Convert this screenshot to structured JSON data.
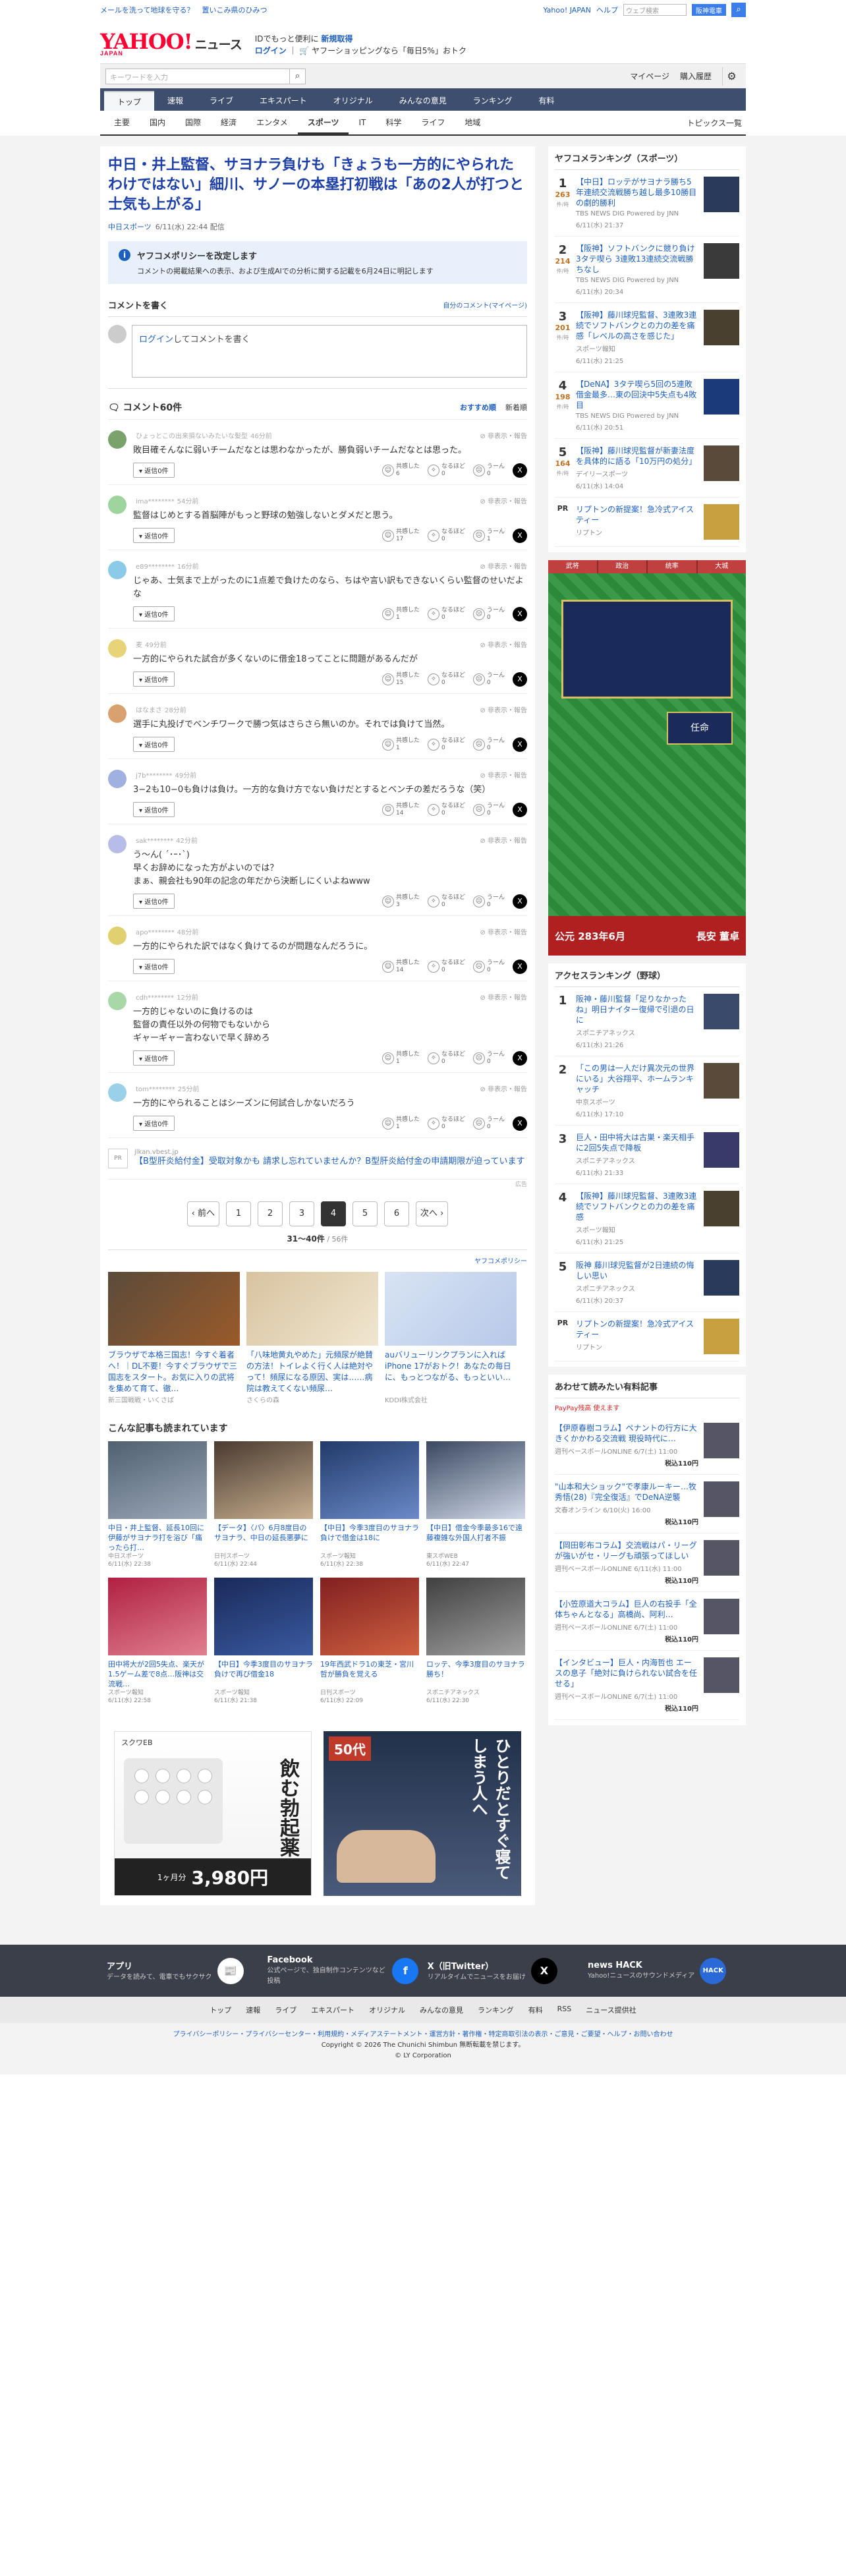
{
  "topbar": {
    "left1": "メールを洗って地球を守る？",
    "left2": "置いこみ県のひみつ",
    "yj": "Yahoo! JAPAN",
    "help": "ヘルプ",
    "search_ph": "ウェブ検索",
    "search_btn": "阪神電車"
  },
  "logo": {
    "main": "YAHOO!",
    "sub": "JAPAN",
    "news": "ニュース"
  },
  "promo": {
    "l1a": "IDでもっと便利に",
    "l1b": "新規取得",
    "l2a": "ログイン",
    "l2b": "ヤフーショッピングなら「毎日5%」おトク"
  },
  "tool": {
    "search_ph": "キーワードを入力",
    "mypage": "マイページ",
    "history": "購入履歴"
  },
  "gnav": [
    "トップ",
    "速報",
    "ライブ",
    "エキスパート",
    "オリジナル",
    "みんなの意見",
    "ランキング",
    "有料"
  ],
  "snav": [
    "主要",
    "国内",
    "国際",
    "経済",
    "エンタメ",
    "スポーツ",
    "IT",
    "科学",
    "ライフ",
    "地域"
  ],
  "snav_right": "トピックス一覧",
  "article": {
    "title": "中日・井上監督、サヨナラ負けも「きょうも一方的にやられたわけではない」細川、サノーの本塁打初戦は「あの2人が打つと士気も上がる」",
    "source": "中日スポーツ",
    "date": "6/11(水) 22:44 配信"
  },
  "policy": {
    "h": "ヤフコメポリシーを改定します",
    "p": "コメントの掲載結果への表示、および生成AIでの分析に関する記載を6月24日に明記します"
  },
  "comment_form": {
    "h": "コメントを書く",
    "my": "自分のコメント(マイページ)",
    "login": "ログイン",
    "rest": "してコメントを書く"
  },
  "comments_head": {
    "count": "コメント60件",
    "sort1": "おすすめ順",
    "sort2": "新着順"
  },
  "reply_label": "返信0件",
  "report_label": "非表示・報告",
  "rx1": "共感した",
  "rx2": "なるほど",
  "rx3": "うーん",
  "comments": [
    {
      "user": "ひょっとこの出来損ないみたいな髪型",
      "time": "46分前",
      "text": "敗目確そんなに弱いチームだなとは思わなかったが、勝負弱いチームだなとは思った。",
      "a": "6",
      "b": "0",
      "c": "0",
      "color": "#7aa36b"
    },
    {
      "user": "ima********",
      "time": "54分前",
      "text": "監督はじめとする首脳陣がもっと野球の勉強しないとダメだと思う。",
      "a": "17",
      "b": "0",
      "c": "1",
      "color": "#9ed59e"
    },
    {
      "user": "e89********",
      "time": "16分前",
      "text": "じゃあ、士気まで上がったのに1点差で負けたのなら、ちはや言い訳もできないくらい監督のせいだよな",
      "a": "1",
      "b": "0",
      "c": "0",
      "color": "#8ccbe8"
    },
    {
      "user": "麦",
      "time": "49分前",
      "text": "一方的にやられた試合が多くないのに借金18ってことに問題があるんだが",
      "a": "15",
      "b": "0",
      "c": "0",
      "color": "#e8d478"
    },
    {
      "user": "はなまさ",
      "time": "28分前",
      "text": "選手に丸投げでベンチワークで勝つ気はさらさら無いのか。それでは負けて当然。",
      "a": "1",
      "b": "0",
      "c": "0",
      "color": "#d9a070"
    },
    {
      "user": "j7b********",
      "time": "49分前",
      "text": "3−2も10−0も負けは負け。一方的な負け方でない負けだとするとベンチの差だろうな（笑）",
      "a": "14",
      "b": "0",
      "c": "0",
      "color": "#a0b0e0"
    },
    {
      "user": "sak********",
      "time": "42分前",
      "text": "う〜ん( ´･ｰ･`)\n早くお辞めになった方がよいのでは？\nまぁ、親会社も90年の記念の年だから決断しにくいよねwww",
      "a": "3",
      "b": "0",
      "c": "0",
      "color": "#b8bde8"
    },
    {
      "user": "apo********",
      "time": "48分前",
      "text": "一方的にやられた訳ではなく負けてるのが問題なんだろうに。",
      "a": "14",
      "b": "0",
      "c": "0",
      "color": "#e0d070"
    },
    {
      "user": "cdh********",
      "time": "12分前",
      "text": "一方的じゃないのに負けるのは\n監督の責任以外の何物でもないから\nギャーギャー言わないで早く辞めろ",
      "a": "1",
      "b": "0",
      "c": "0",
      "color": "#a8d8a8"
    },
    {
      "user": "tom********",
      "time": "25分前",
      "text": "一方的にやられることはシーズンに何試合しかないだろう",
      "a": "1",
      "b": "0",
      "c": "0",
      "color": "#9ad0e8"
    }
  ],
  "ad_text": {
    "sponsor": "jlkan.vbest.jp",
    "text": "【B型肝炎給付金】受取対象かも 請求し忘れていませんか？B型肝炎給付金の申請期限が迫っています",
    "icon": "PR",
    "adlabel": "広告"
  },
  "pager": {
    "prev": "前へ",
    "pages": [
      "1",
      "2",
      "3",
      "4",
      "5",
      "6"
    ],
    "next": "次へ",
    "count": "31〜40件",
    "total": " / 56件"
  },
  "yahoo_policy": "ヤフコメポリシー",
  "adgrid": [
    {
      "text": "ブラウザで本格三国志！今すぐ着者へ！｜DL不要！今すぐブラウザで三国志をスタート。お気に入りの武将を集めて育て、徹…",
      "sp": "新三国戦戦・いくさば",
      "c1": "#5a4b3a",
      "c2": "#9a5a2a"
    },
    {
      "text": "「八味地黄丸やめた」元頻尿が絶賛の方法！トイレよく行く人は絶対やって！頻尿になる原因、実は……病院は教えてくない頻尿…",
      "sp": "さくらの森",
      "c1": "#d8c3a0",
      "c2": "#f0e6d0"
    },
    {
      "text": "auバリューリンクプランに入ればiPhone 17がおトク！あなたの毎日に、もっとつながる、もっといい…",
      "sp": "KDDI株式会社",
      "c1": "#d8e4f4",
      "c2": "#b8c8e8"
    }
  ],
  "also_h": "こんな記事も読まれています",
  "also": [
    {
      "t": "中日・井上監督、延長10回に伊藤がサヨナラ打を浴び「痛ったら打…",
      "s": "中日スポーツ",
      "d": "6/11(水) 22:38",
      "c1": "#506070",
      "c2": "#9aa7b8"
    },
    {
      "t": "【データ】〈パ〉6月8度目のサヨナラ、中日の延長悪夢に",
      "s": "日刊スポーツ",
      "d": "6/11(水) 22:44",
      "c1": "#4a3a30",
      "c2": "#c8b090"
    },
    {
      "t": "【中日】今季3度目のサヨナラ負けで借金は18に",
      "s": "スポーツ報知",
      "d": "6/11(水) 22:38",
      "c1": "#223a6a",
      "c2": "#6a8ac8"
    },
    {
      "t": "【中日】借金今季最多16で遠藤複雑な外国人打者不振",
      "s": "東スポWEB",
      "d": "6/11(水) 22:47",
      "c1": "#3a4860",
      "c2": "#d0d8e8"
    },
    {
      "t": "田中将大が2回5失点、楽天が1.5ゲーム差で8点…阪神は交流戦…",
      "s": "スポーツ報知",
      "d": "6/11(水) 22:58",
      "c1": "#b02040",
      "c2": "#e08090"
    },
    {
      "t": "【中日】今季3度目のサヨナラ負けで再び借金18",
      "s": "スポーツ報知",
      "d": "6/11(水) 21:38",
      "c1": "#1a2a5a",
      "c2": "#3a5aa0"
    },
    {
      "t": "19年西武ドラ1の東芝・宮川哲が勝負を覚える",
      "s": "日刊スポーツ",
      "d": "6/11(水) 22:09",
      "c1": "#802020",
      "c2": "#d06040"
    },
    {
      "t": "ロッテ、今季3度目のサヨナラ勝ち！",
      "s": "スポニチアネックス",
      "d": "6/11(水) 22:30",
      "c1": "#404040",
      "c2": "#a0a0a0"
    }
  ],
  "bigad1": {
    "brand": "スクワEB",
    "head": "飲む勃起薬",
    "price": "3,980円",
    "sub": "1ヶ月分"
  },
  "bigad2": {
    "age": "50代",
    "head": "ひとりだとすぐ寝てしまう人へ"
  },
  "side_rank_h": "ヤフコメランキング（スポーツ）",
  "side_rank": [
    {
      "n": "1",
      "cnt": "263",
      "unit": "件/時",
      "t": "【中日】ロッテがサヨナラ勝ち5年連続交流戦勝ち越し最多10勝目の劇的勝利",
      "s": "TBS NEWS DIG Powered by JNN",
      "d": "6/11(水) 21:37",
      "c1": "#2a3a5a"
    },
    {
      "n": "2",
      "cnt": "214",
      "unit": "件/時",
      "t": "【阪神】ソフトバンクに競り負け 3タテ喫ら 3連敗13連続交流戦勝ちなし",
      "s": "TBS NEWS DIG Powered by JNN",
      "d": "6/11(水) 20:34",
      "c1": "#3a3a3a"
    },
    {
      "n": "3",
      "cnt": "201",
      "unit": "件/時",
      "t": "【阪神】藤川球児監督、3連敗3連続でソフトバンクとの力の差を痛感「レベルの高さを感じた」",
      "s": "スポーツ報知",
      "d": "6/11(水) 21:25",
      "c1": "#4a4030"
    },
    {
      "n": "4",
      "cnt": "198",
      "unit": "件/時",
      "t": "【DeNA】3タテ喫ら5回の5連敗 借金最多…東の回決中5失点も4敗目",
      "s": "TBS NEWS DIG Powered by JNN",
      "d": "6/11(水) 20:51",
      "c1": "#1a3a7a"
    },
    {
      "n": "5",
      "cnt": "164",
      "unit": "件/時",
      "t": "【阪神】藤川球児監督が新妻法度を具体的に語る「10万円の処分」",
      "s": "デイリースポーツ",
      "d": "6/11(水) 14:04",
      "c1": "#5a4a3a"
    }
  ],
  "side_pr": {
    "icon": "PR",
    "t": "リプトンの新提案！急冷式アイスティー",
    "s": "リプトン"
  },
  "gamead": {
    "year": "公元 283年6月",
    "place": "長安 董卓",
    "btn": "任命",
    "chars": [
      "武将",
      "政治",
      "统率",
      "大城"
    ]
  },
  "access_h": "アクセスランキング（野球）",
  "access": [
    {
      "n": "1",
      "t": "阪神・藤川監督「足りなかったね」明日ナイター復帰で引退の日に",
      "s": "スポニチアネックス",
      "d": "6/11(水) 21:26",
      "c1": "#3a4a6a"
    },
    {
      "n": "2",
      "t": "「この男は一人だけ異次元の世界にいる」大谷翔平、ホームランキャッチ",
      "s": "中京スポーツ",
      "d": "6/11(水) 17:10",
      "c1": "#5a4a3a"
    },
    {
      "n": "3",
      "t": "巨人・田中将大は古巣・楽天相手に2回5失点で降板",
      "s": "スポニチアネックス",
      "d": "6/11(水) 21:33",
      "c1": "#3a3a6a"
    },
    {
      "n": "4",
      "t": "【阪神】藤川球児監督、3連敗3連続でソフトバンクとの力の差を痛感",
      "s": "スポーツ報知",
      "d": "6/11(水) 21:25",
      "c1": "#4a4030"
    },
    {
      "n": "5",
      "t": "阪神 藤川球児監督が2日連続の悔しい思い",
      "s": "スポニチアネックス",
      "d": "6/11(水) 20:37",
      "c1": "#2a3a5a"
    }
  ],
  "access_pr": {
    "icon": "PR",
    "t": "リプトンの新提案！急冷式アイスティー",
    "s": "リプトン"
  },
  "paid_h": "あわせて読みたい有料記事",
  "paid_brand": "PayPay残高 使えます",
  "paid": [
    {
      "t": "【伊原春樹コラム】ペナントの行方に大きくかかわる交流戦 現役時代に…",
      "s": "週刊ベースボールONLINE",
      "d": "6/7(土) 11:00",
      "p": "税込110円"
    },
    {
      "t": "\"山本和大ショック\"で孝康ルーキー…牧秀悟(28)『完全復活』でDeNA逆襲",
      "s": "文春オンライン",
      "d": "6/10(火) 16:00",
      "p": "税込110円"
    },
    {
      "t": "【岡田彰布コラム】交流戦はパ・リーグが強いがセ・リーグも頑張ってほしい",
      "s": "週刊ベースボールONLINE",
      "d": "6/11(水) 11:00",
      "p": "税込110円"
    },
    {
      "t": "【小笠原道大コラム】巨人の右投手「全体ちゃんとなる」高橋尚、阿利…",
      "s": "週刊ベースボールONLINE",
      "d": "6/7(土) 11:00",
      "p": "税込110円"
    },
    {
      "t": "【インタビュー】巨人・内海哲也 エースの息子「絶対に負けられない試合を任せる」",
      "s": "週刊ベースボールONLINE",
      "d": "6/7(土) 11:00",
      "p": "税込110円"
    }
  ],
  "footer": {
    "cards": [
      {
        "h": "アプリ",
        "p": "データを読みて、電車でもサクサク",
        "ico": "📰",
        "bg": "#fff",
        "fg": "#1d5fbf"
      },
      {
        "h": "Facebook",
        "p": "公式ページで、独自制作コンテンツなど投稿",
        "ico": "f",
        "bg": "#1877f2",
        "fg": "#fff"
      },
      {
        "h": "X（旧Twitter）",
        "p": "リアルタイムでニュースをお届け",
        "ico": "X",
        "bg": "#000",
        "fg": "#fff"
      },
      {
        "h": "news HACK",
        "p": "Yahoo!ニュースのサウンドメディア",
        "ico": "HACK",
        "bg": "#2a6ad8",
        "fg": "#fff"
      }
    ],
    "nav": [
      "トップ",
      "速報",
      "ライブ",
      "エキスパート",
      "オリジナル",
      "みんなの意見",
      "ランキング",
      "有料",
      "RSS",
      "ニュース提供社"
    ],
    "links": "プライバシーポリシー・プライバシーセンター・利用規約・メディアステートメント・運営方針・著作権・特定商取引法の表示・ご意見・ご要望・ヘルプ・お問い合わせ",
    "copy1": "Copyright © 2026 The Chunichi Shimbun 無断転載を禁じます。",
    "copy2": "© LY Corporation"
  }
}
